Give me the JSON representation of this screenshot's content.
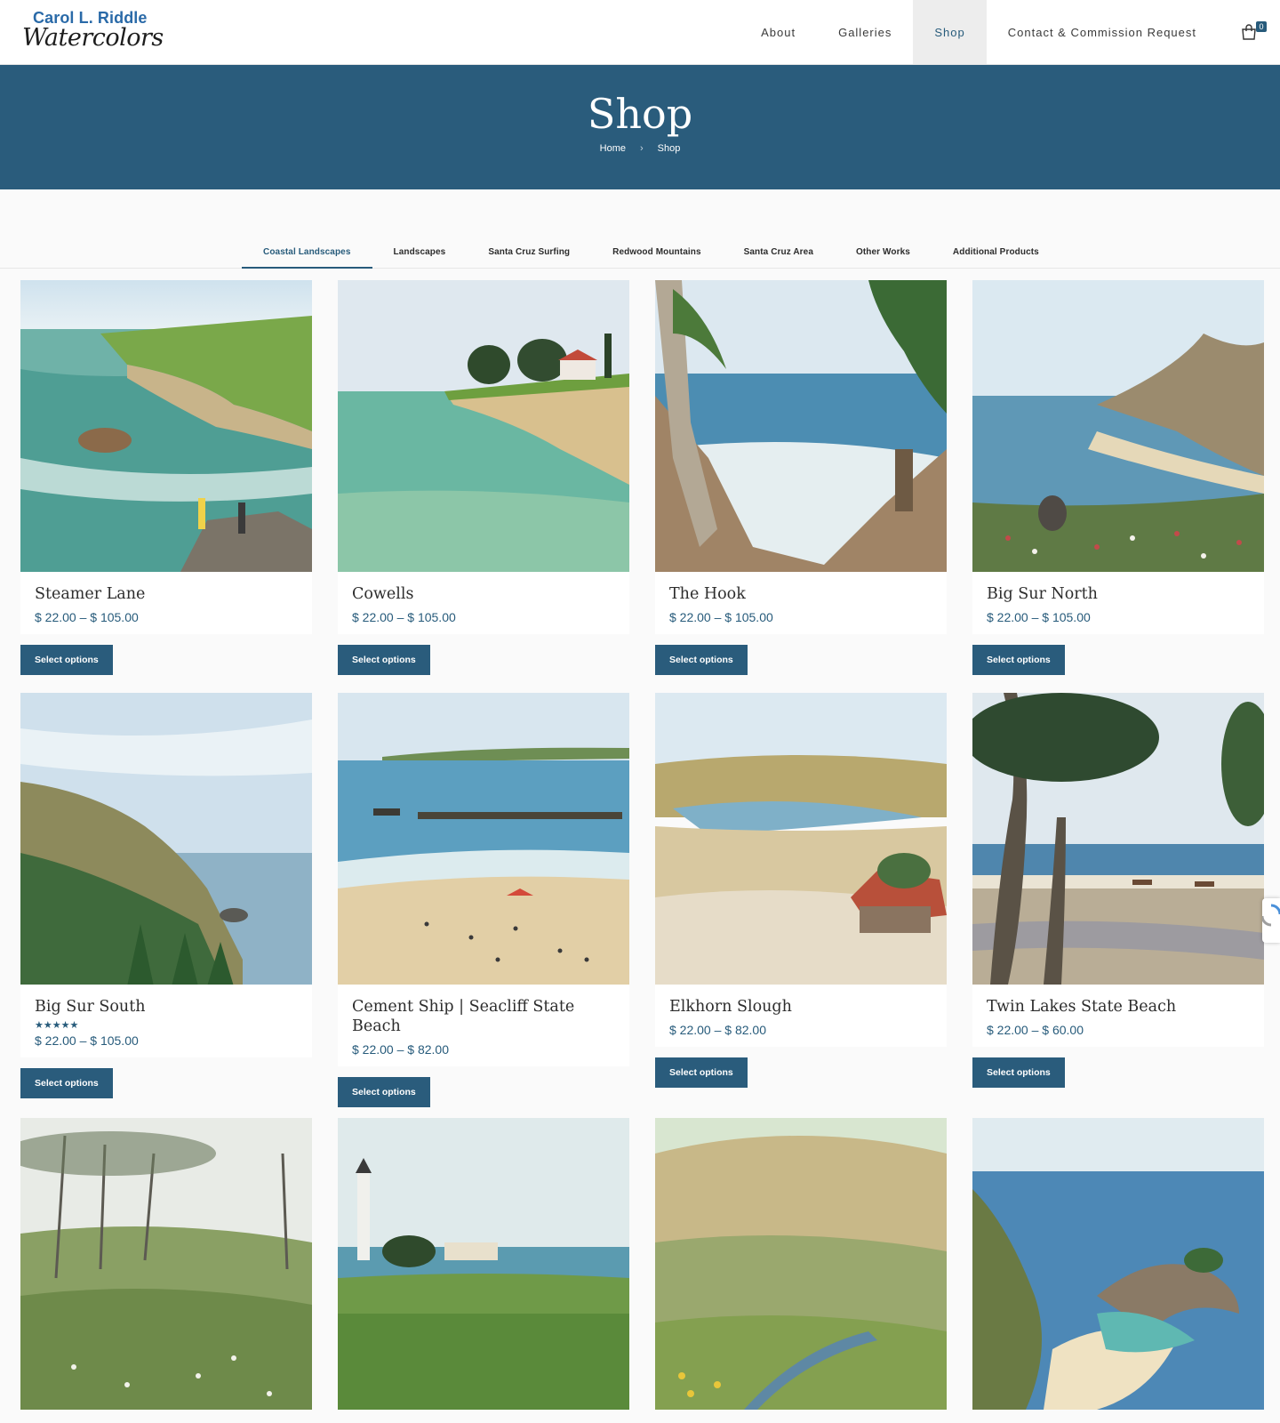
{
  "logo": {
    "line1": "Carol L. Riddle",
    "line2": "Watercolors"
  },
  "nav": {
    "items": [
      {
        "label": "About"
      },
      {
        "label": "Galleries"
      },
      {
        "label": "Shop"
      },
      {
        "label": "Contact & Commission Request"
      }
    ],
    "cart_count": "0"
  },
  "banner": {
    "title": "Shop",
    "breadcrumb": [
      "Home",
      "Shop"
    ]
  },
  "tabs": [
    {
      "label": "Coastal Landscapes"
    },
    {
      "label": "Landscapes"
    },
    {
      "label": "Santa Cruz Surfing"
    },
    {
      "label": "Redwood Mountains"
    },
    {
      "label": "Santa Cruz Area"
    },
    {
      "label": "Other Works"
    },
    {
      "label": "Additional Products"
    }
  ],
  "products": [
    {
      "title": "Steamer Lane",
      "price": "$ 22.00 – $ 105.00",
      "button": "Select options"
    },
    {
      "title": "Cowells",
      "price": "$ 22.00 – $ 105.00",
      "button": "Select options"
    },
    {
      "title": "The Hook",
      "price": "$ 22.00 – $ 105.00",
      "button": "Select options"
    },
    {
      "title": "Big Sur North",
      "price": "$ 22.00 – $ 105.00",
      "button": "Select options"
    },
    {
      "title": "Big Sur South",
      "rating": "★★★★★",
      "price": "$ 22.00 – $ 105.00",
      "button": "Select options"
    },
    {
      "title": "Cement Ship | Seacliff State Beach",
      "price": "$ 22.00 – $ 82.00",
      "button": "Select options"
    },
    {
      "title": "Elkhorn Slough",
      "price": "$ 22.00 – $ 82.00",
      "button": "Select options"
    },
    {
      "title": "Twin Lakes State Beach",
      "price": "$ 22.00 – $ 60.00",
      "button": "Select options"
    }
  ],
  "colors": {
    "primary": "#2a5c7c",
    "accent_text": "#275b7b",
    "logo_blue": "#2a6aa8"
  }
}
